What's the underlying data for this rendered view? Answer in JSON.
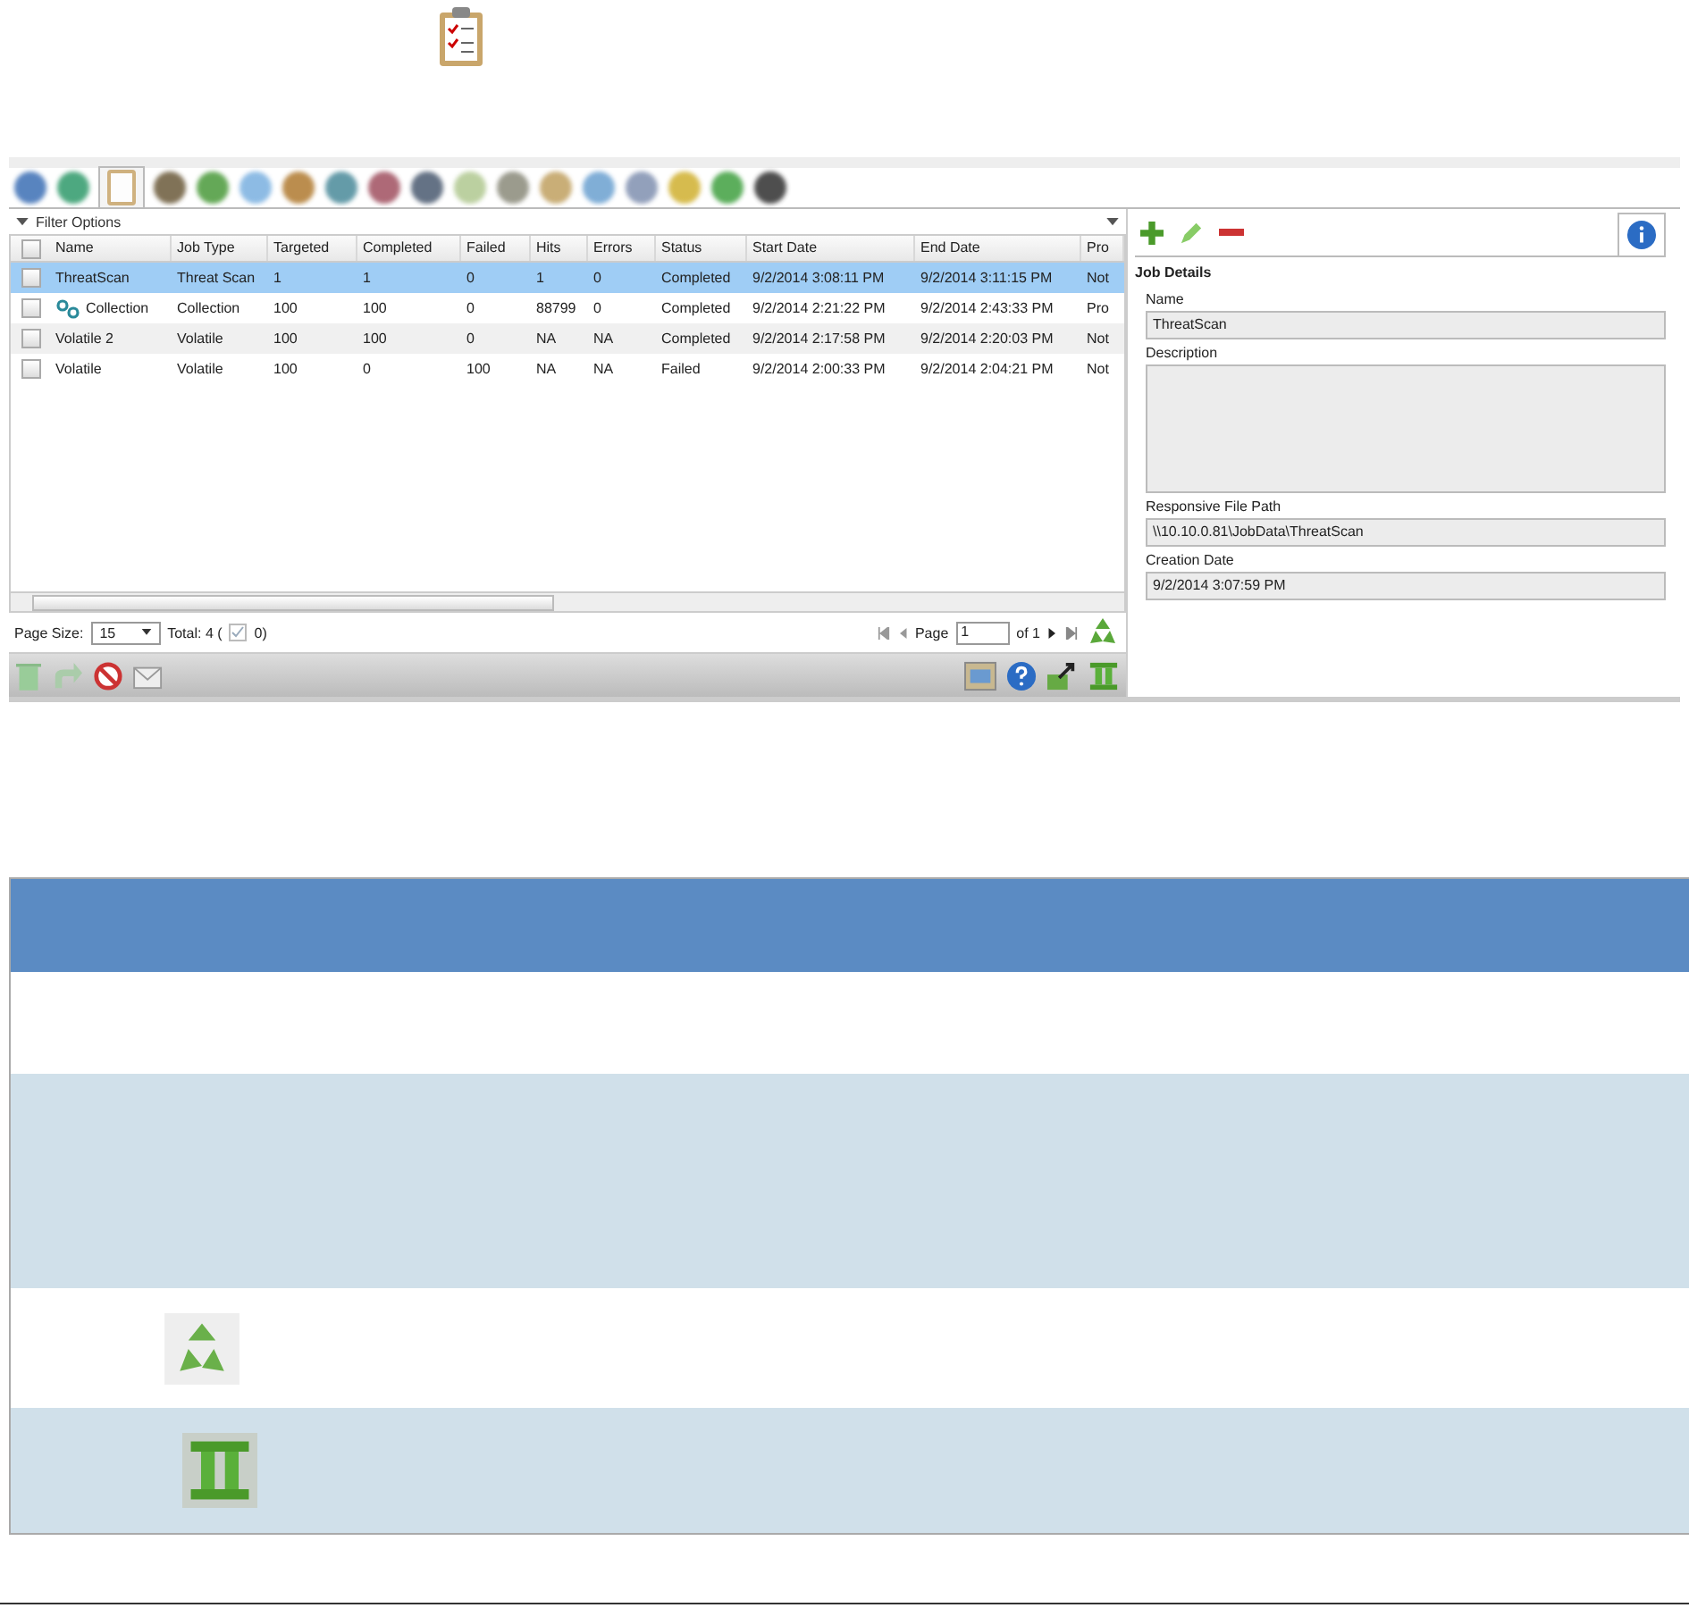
{
  "module_tabs": [
    {
      "selected": false
    },
    {
      "selected": false
    },
    {
      "selected": true
    },
    {
      "selected": false
    },
    {
      "selected": false
    },
    {
      "selected": false
    },
    {
      "selected": false
    },
    {
      "selected": false
    },
    {
      "selected": false
    },
    {
      "selected": false
    },
    {
      "selected": false
    },
    {
      "selected": false
    },
    {
      "selected": false
    },
    {
      "selected": false
    },
    {
      "selected": false
    },
    {
      "selected": false
    },
    {
      "selected": false
    },
    {
      "selected": false
    }
  ],
  "filter_options": "Filter Options",
  "jobs_table": {
    "columns": [
      "Name",
      "Job Type",
      "Targeted",
      "Completed",
      "Failed",
      "Hits",
      "Errors",
      "Status",
      "Start Date",
      "End Date",
      "Pro"
    ],
    "select_all_checked": false,
    "rows": [
      {
        "selected": true,
        "checked": false,
        "kind": "plain",
        "cells": [
          "ThreatScan",
          "Threat Scan",
          "1",
          "1",
          "0",
          "1",
          "0",
          "Completed",
          "9/2/2014 3:08:11 PM",
          "9/2/2014 3:11:15 PM",
          "Not"
        ]
      },
      {
        "selected": false,
        "checked": false,
        "kind": "collection",
        "cells": [
          "Collection",
          "Collection",
          "100",
          "100",
          "0",
          "88799",
          "0",
          "Completed",
          "9/2/2014 2:21:22 PM",
          "9/2/2014 2:43:33 PM",
          "Pro"
        ]
      },
      {
        "selected": false,
        "checked": false,
        "kind": "plain",
        "cells": [
          "Volatile 2",
          "Volatile",
          "100",
          "100",
          "0",
          "NA",
          "NA",
          "Completed",
          "9/2/2014 2:17:58 PM",
          "9/2/2014 2:20:03 PM",
          "Not"
        ]
      },
      {
        "selected": false,
        "checked": false,
        "kind": "plain",
        "cells": [
          "Volatile",
          "Volatile",
          "100",
          "0",
          "100",
          "NA",
          "NA",
          "Failed",
          "9/2/2014 2:00:33 PM",
          "9/2/2014 2:04:21 PM",
          "Not"
        ]
      }
    ]
  },
  "pager": {
    "page_size_label": "Page Size:",
    "page_size": "15",
    "total": "Total: 4 (",
    "total_checked": "0)",
    "page_label": "Page",
    "page": "1",
    "of": "of 1"
  },
  "job_details": {
    "title": "Job Details",
    "fields": [
      {
        "label": "Name",
        "value": "ThreatScan",
        "kind": "line"
      },
      {
        "label": "Description",
        "kind": "area"
      },
      {
        "label": "Responsive File Path",
        "value": "\\\\10.10.0.81\\JobData\\ThreatScan",
        "kind": "line"
      },
      {
        "label": "Creation Date",
        "value": "9/2/2014 3:07:59 PM",
        "kind": "line"
      }
    ]
  },
  "doc_table": {
    "rows": [
      {
        "kind": "header"
      },
      {
        "kind": "blank"
      },
      {
        "kind": "tall"
      },
      {
        "kind": "recycle"
      },
      {
        "kind": "pillar"
      }
    ]
  }
}
